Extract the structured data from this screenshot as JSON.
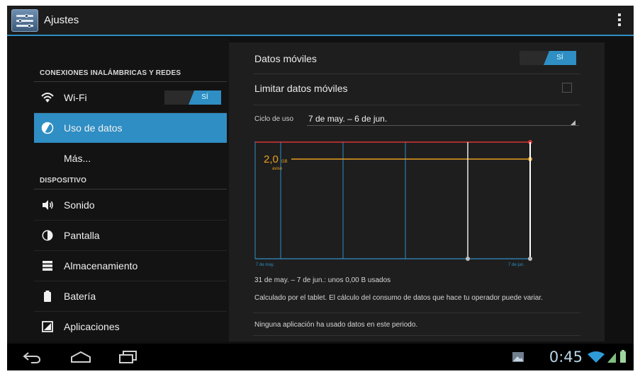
{
  "app": {
    "title": "Ajustes"
  },
  "sidebar": {
    "section_wireless": "CONEXIONES INALÁMBRICAS Y REDES",
    "section_device": "DISPOSITIVO",
    "items": [
      {
        "label": "Wi-Fi",
        "icon": "wifi-icon",
        "toggle": "SÍ"
      },
      {
        "label": "Uso de datos",
        "icon": "data-usage-icon",
        "active": true
      },
      {
        "label": "Más..."
      },
      {
        "label": "Sonido",
        "icon": "speaker-icon"
      },
      {
        "label": "Pantalla",
        "icon": "display-icon"
      },
      {
        "label": "Almacenamiento",
        "icon": "storage-icon"
      },
      {
        "label": "Batería",
        "icon": "battery-icon"
      },
      {
        "label": "Aplicaciones",
        "icon": "apps-icon"
      }
    ]
  },
  "detail": {
    "mobile_data_label": "Datos móviles",
    "mobile_data_toggle": "SÍ",
    "limit_label": "Limitar datos móviles",
    "cycle_label": "Ciclo de uso",
    "cycle_value": "7 de may. – 6 de jun.",
    "usage_text": "31 de may. – 7 de jun.: unos 0,00 B usados",
    "note_text": "Calculado por el tablet. El cálculo del consumo de datos que hace tu operador puede variar.",
    "no_apps_text": "Ninguna aplicación ha usado datos en este periodo."
  },
  "chart_data": {
    "type": "line",
    "warning_value": "2,0",
    "warning_unit": "GB",
    "warning_label": "aviso",
    "x_start_label": "7 de may.",
    "x_end_label": "7 de jun."
  },
  "navbar": {
    "clock": "0:45"
  },
  "colors": {
    "accent": "#2f8ec4",
    "limit": "#d83434",
    "warning": "#e8a020"
  }
}
